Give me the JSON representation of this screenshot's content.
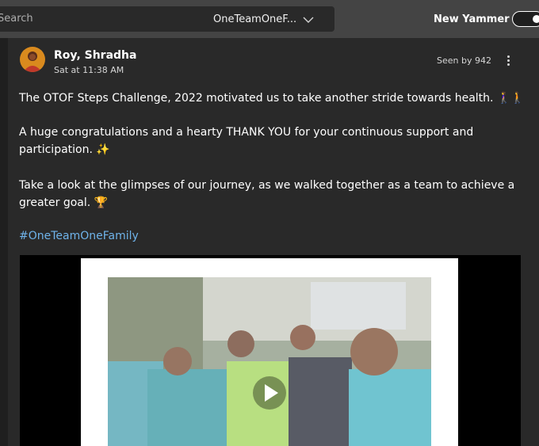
{
  "header": {
    "search_placeholder": "Search",
    "community_name": "OneTeamOneF...",
    "new_yammer_label": "New Yammer",
    "new_yammer_enabled": true
  },
  "post": {
    "author": "Roy, Shradha",
    "timestamp": "Sat at 11:38 AM",
    "seen_by": "Seen by 942",
    "paragraph1": "The OTOF Steps Challenge, 2022 motivated us to take another stride towards health. 🚶‍♀️🚶",
    "paragraph2": "A huge congratulations and a hearty THANK YOU for your continuous support and participation. ✨",
    "paragraph3": "Take a look at the glimpses of our journey, as we walked together as a team to achieve a greater goal. 🏆",
    "hashtag": "#OneTeamOneFamily",
    "media_type": "video"
  },
  "colors": {
    "top_bar": "#444444",
    "card_bg": "#292929",
    "hashtag": "#6fb3ea"
  },
  "icons": [
    "chevron-down-icon",
    "more-options-icon",
    "play-icon"
  ]
}
